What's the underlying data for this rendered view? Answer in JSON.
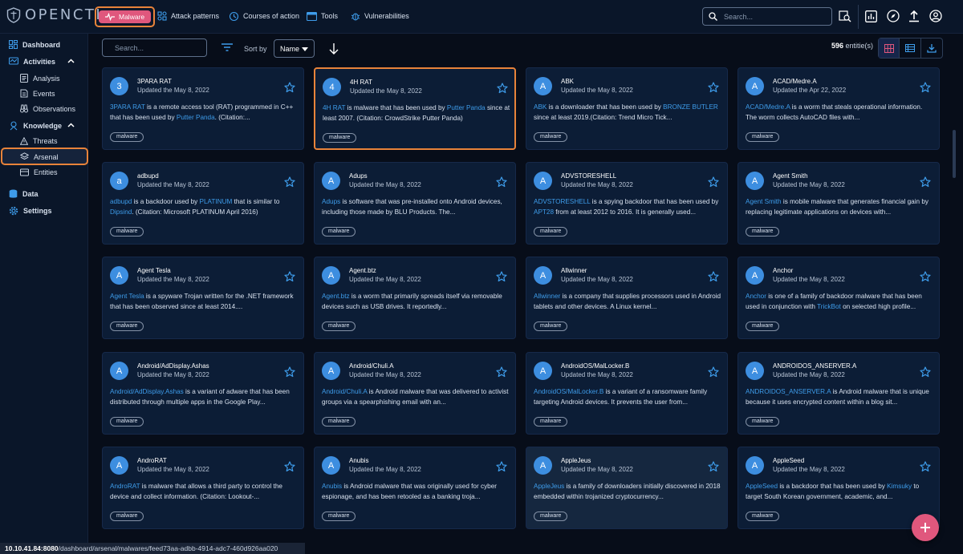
{
  "app": {
    "name": "OPENCTI"
  },
  "topnav": {
    "items": [
      {
        "label": "Malware",
        "icon": "malware-icon",
        "active": true
      },
      {
        "label": "Attack patterns",
        "icon": "attack-pattern-icon"
      },
      {
        "label": "Courses of action",
        "icon": "course-of-action-icon"
      },
      {
        "label": "Tools",
        "icon": "tools-icon"
      },
      {
        "label": "Vulnerabilities",
        "icon": "vulnerability-icon"
      }
    ],
    "search_placeholder": "Search..."
  },
  "sidebar": {
    "dashboard": "Dashboard",
    "activities": "Activities",
    "analysis": "Analysis",
    "events": "Events",
    "observations": "Observations",
    "knowledge": "Knowledge",
    "threats": "Threats",
    "arsenal": "Arsenal",
    "entities": "Entities",
    "data": "Data",
    "settings": "Settings"
  },
  "toolbar": {
    "search_placeholder": "Search...",
    "sort_label": "Sort by",
    "sort_value": "Name",
    "count_number": "596",
    "count_suffix": " entitie(s)"
  },
  "status_url": {
    "host": "10.10.41.84:8080",
    "path": "/dashboard/arsenal/malwares/feed73aa-adbb-4914-adc7-460d926aa020"
  },
  "colors": {
    "accent": "#e0577d",
    "link": "#3e9cea",
    "highlight": "#e8833a",
    "avatar": "#3d8ee0"
  },
  "cards": [
    {
      "initial": "3",
      "name": "3PARA RAT",
      "date": "Updated the May 8, 2022",
      "desc": [
        [
          "3PARA RAT",
          true
        ],
        [
          " is a remote access tool (RAT) programmed in C++ that has been used by ",
          false
        ],
        [
          "Putter Panda",
          true
        ],
        [
          ". (Citation:...",
          false
        ]
      ],
      "tag": "malware"
    },
    {
      "initial": "4",
      "name": "4H RAT",
      "date": "Updated the May 8, 2022",
      "desc": [
        [
          "4H RAT",
          true
        ],
        [
          " is malware that has been used by ",
          false
        ],
        [
          "Putter Panda",
          true
        ],
        [
          " since at least 2007. (Citation: CrowdStrike Putter Panda)",
          false
        ]
      ],
      "tag": "malware"
    },
    {
      "initial": "A",
      "name": "ABK",
      "date": "Updated the May 8, 2022",
      "desc": [
        [
          "ABK",
          true
        ],
        [
          " is a downloader that has been used by ",
          false
        ],
        [
          "BRONZE BUTLER",
          true
        ],
        [
          " since at least 2019.(Citation: Trend Micro Tick...",
          false
        ]
      ],
      "tag": "malware"
    },
    {
      "initial": "A",
      "name": "ACAD/Medre.A",
      "date": "Updated the Apr 22, 2022",
      "desc": [
        [
          "ACAD/Medre.A",
          true
        ],
        [
          " is a worm that steals operational information. The worm collects AutoCAD files with...",
          false
        ]
      ],
      "tag": "malware"
    },
    {
      "initial": "a",
      "name": "adbupd",
      "date": "Updated the May 8, 2022",
      "desc": [
        [
          "adbupd",
          true
        ],
        [
          " is a backdoor used by ",
          false
        ],
        [
          "PLATINUM",
          true
        ],
        [
          " that is similar to ",
          false
        ],
        [
          "Dipsind",
          true
        ],
        [
          ". (Citation: Microsoft PLATINUM April 2016)",
          false
        ]
      ],
      "tag": "malware"
    },
    {
      "initial": "A",
      "name": "Adups",
      "date": "Updated the May 8, 2022",
      "desc": [
        [
          "Adups",
          true
        ],
        [
          " is software that was pre-installed onto Android devices, including those made by BLU Products. The...",
          false
        ]
      ],
      "tag": "malware"
    },
    {
      "initial": "A",
      "name": "ADVSTORESHELL",
      "date": "Updated the May 8, 2022",
      "desc": [
        [
          "ADVSTORESHELL",
          true
        ],
        [
          " is a spying backdoor that has been used by ",
          false
        ],
        [
          "APT28",
          true
        ],
        [
          " from at least 2012 to 2016. It is generally used...",
          false
        ]
      ],
      "tag": "malware"
    },
    {
      "initial": "A",
      "name": "Agent Smith",
      "date": "Updated the May 8, 2022",
      "desc": [
        [
          "Agent Smith",
          true
        ],
        [
          " is mobile malware that generates financial gain by replacing legitimate applications on devices with...",
          false
        ]
      ],
      "tag": "malware"
    },
    {
      "initial": "A",
      "name": "Agent Tesla",
      "date": "Updated the May 8, 2022",
      "desc": [
        [
          "Agent Tesla",
          true
        ],
        [
          " is a spyware Trojan written for the .NET framework that has been observed since at least 2014....",
          false
        ]
      ],
      "tag": "malware"
    },
    {
      "initial": "A",
      "name": "Agent.btz",
      "date": "Updated the May 8, 2022",
      "desc": [
        [
          "Agent.btz",
          true
        ],
        [
          " is a worm that primarily spreads itself via removable devices such as USB drives. It reportedly...",
          false
        ]
      ],
      "tag": "malware"
    },
    {
      "initial": "A",
      "name": "Allwinner",
      "date": "Updated the May 8, 2022",
      "desc": [
        [
          "Allwinner",
          true
        ],
        [
          " is a company that supplies processors used in Android tablets and other devices. A Linux kernel...",
          false
        ]
      ],
      "tag": "malware"
    },
    {
      "initial": "A",
      "name": "Anchor",
      "date": "Updated the May 8, 2022",
      "desc": [
        [
          "Anchor",
          true
        ],
        [
          " is one of a family of backdoor malware that has been used in conjunction with ",
          false
        ],
        [
          "TrickBot",
          true
        ],
        [
          " on selected high profile...",
          false
        ]
      ],
      "tag": "malware"
    },
    {
      "initial": "A",
      "name": "Android/AdDisplay.Ashas",
      "date": "Updated the May 8, 2022",
      "desc": [
        [
          "Android/AdDisplay.Ashas",
          true
        ],
        [
          " is a variant of adware that has been distributed through multiple apps in the Google Play...",
          false
        ]
      ],
      "tag": "malware"
    },
    {
      "initial": "A",
      "name": "Android/Chuli.A",
      "date": "Updated the May 8, 2022",
      "desc": [
        [
          "Android/Chuli.A",
          true
        ],
        [
          " is Android malware that was delivered to activist groups via a spearphishing email with an...",
          false
        ]
      ],
      "tag": "malware"
    },
    {
      "initial": "A",
      "name": "AndroidOS/MalLocker.B",
      "date": "Updated the May 8, 2022",
      "desc": [
        [
          "AndroidOS/MalLocker.B",
          true
        ],
        [
          " is a variant of a ransomware family targeting Android devices. It prevents the user from...",
          false
        ]
      ],
      "tag": "malware"
    },
    {
      "initial": "A",
      "name": "ANDROIDOS_ANSERVER.A",
      "date": "Updated the May 8, 2022",
      "desc": [
        [
          "ANDROIDOS_ANSERVER.A",
          true
        ],
        [
          " is Android malware that is unique because it uses encrypted content within a blog sit...",
          false
        ]
      ],
      "tag": "malware"
    },
    {
      "initial": "A",
      "name": "AndroRAT",
      "date": "Updated the May 8, 2022",
      "desc": [
        [
          "AndroRAT",
          true
        ],
        [
          " is malware that allows a third party to control the device and collect information. (Citation: Lookout-...",
          false
        ]
      ],
      "tag": "malware"
    },
    {
      "initial": "A",
      "name": "Anubis",
      "date": "Updated the May 8, 2022",
      "desc": [
        [
          "Anubis",
          true
        ],
        [
          " is Android malware that was originally used for cyber espionage, and has been retooled as a banking troja...",
          false
        ]
      ],
      "tag": "malware"
    },
    {
      "initial": "A",
      "name": "AppleJeus",
      "date": "Updated the May 8, 2022",
      "desc": [
        [
          "AppleJeus",
          true
        ],
        [
          " is a family of downloaders initially discovered in 2018 embedded within trojanized cryptocurrency...",
          false
        ]
      ],
      "tag": "malware"
    },
    {
      "initial": "A",
      "name": "AppleSeed",
      "date": "Updated the May 8, 2022",
      "desc": [
        [
          "AppleSeed",
          true
        ],
        [
          " is a backdoor that has been used by ",
          false
        ],
        [
          "Kimsuky",
          true
        ],
        [
          " to target South Korean government, academic, and...",
          false
        ]
      ],
      "tag": "malware"
    }
  ]
}
